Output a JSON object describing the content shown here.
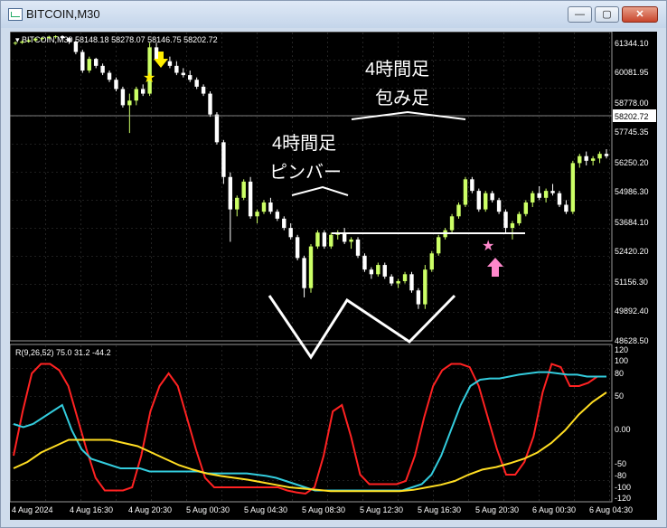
{
  "window": {
    "title": "BITCOIN,M30",
    "buttons": {
      "minimize": "—",
      "maximize": "▢",
      "close": "✕"
    }
  },
  "chart": {
    "info_line": "▾ BITCOIN,M30  58148.18 58278.07 58146.75 58202.72",
    "current_price": "58202.72",
    "price_axis": [
      "61344.10",
      "60081.95",
      "58778.00",
      "57745.35",
      "56250.20",
      "54986.30",
      "53684.10",
      "52420.20",
      "51156.30",
      "49892.40",
      "48628.50"
    ],
    "annotations": {
      "pinbar_line1": "4時間足",
      "pinbar_line2": "ピンバー",
      "engulf_line1": "4時間足",
      "engulf_line2": "包み足"
    },
    "colors": {
      "bull": "#ccff66",
      "bear": "#ffffff",
      "star_yellow": "#ffee00",
      "star_pink": "#ff88cc"
    }
  },
  "indicator": {
    "label": "R(9,26,52) 75.0 31.2 -44.2",
    "axis": [
      "120",
      "100",
      "80",
      "50",
      "0.00",
      "-50",
      "-80",
      "-100",
      "-120"
    ]
  },
  "time_axis": [
    "4 Aug 2024",
    "4 Aug 16:30",
    "4 Aug 20:30",
    "5 Aug 00:30",
    "5 Aug 04:30",
    "5 Aug 08:30",
    "5 Aug 12:30",
    "5 Aug 16:30",
    "5 Aug 20:30",
    "6 Aug 00:30",
    "6 Aug 04:30"
  ],
  "chart_data": {
    "type": "candlestick",
    "symbol": "BITCOIN",
    "timeframe": "M30",
    "price_ohlc": [
      [
        61180,
        61260,
        61100,
        61200
      ],
      [
        61200,
        61300,
        61150,
        61250
      ],
      [
        61250,
        61350,
        61200,
        61300
      ],
      [
        61300,
        61420,
        61250,
        61380
      ],
      [
        61380,
        61450,
        61300,
        61400
      ],
      [
        61400,
        61500,
        61350,
        61450
      ],
      [
        61450,
        61520,
        61380,
        61480
      ],
      [
        61480,
        61520,
        61350,
        61400
      ],
      [
        61400,
        61450,
        61150,
        61250
      ],
      [
        61250,
        61300,
        60700,
        60800
      ],
      [
        60800,
        60900,
        59900,
        60000
      ],
      [
        60000,
        60600,
        59900,
        60500
      ],
      [
        60500,
        60550,
        60100,
        60200
      ],
      [
        60200,
        60300,
        59800,
        59900
      ],
      [
        59900,
        60000,
        59500,
        59600
      ],
      [
        59600,
        59700,
        59100,
        59200
      ],
      [
        59200,
        59300,
        58400,
        58500
      ],
      [
        58500,
        59000,
        57300,
        58700
      ],
      [
        58700,
        59300,
        58500,
        59200
      ],
      [
        59200,
        59400,
        58900,
        59000
      ],
      [
        59000,
        61200,
        58900,
        61000
      ],
      [
        61000,
        61200,
        60400,
        60500
      ],
      [
        60500,
        60700,
        60300,
        60400
      ],
      [
        60400,
        60600,
        60100,
        60200
      ],
      [
        60200,
        60400,
        59800,
        59900
      ],
      [
        59900,
        60100,
        59700,
        59800
      ],
      [
        59800,
        60000,
        59500,
        59600
      ],
      [
        59600,
        59700,
        59200,
        59300
      ],
      [
        59300,
        59400,
        58900,
        59000
      ],
      [
        59000,
        59100,
        58000,
        58100
      ],
      [
        58100,
        58200,
        56800,
        56900
      ],
      [
        56900,
        57000,
        55100,
        55400
      ],
      [
        55400,
        55600,
        52600,
        54000
      ],
      [
        54000,
        54600,
        53700,
        54500
      ],
      [
        54500,
        55300,
        54400,
        55200
      ],
      [
        55200,
        55400,
        53600,
        53700
      ],
      [
        53700,
        54000,
        53400,
        53900
      ],
      [
        53900,
        54400,
        53800,
        54300
      ],
      [
        54300,
        54500,
        53800,
        53900
      ],
      [
        53900,
        54000,
        53500,
        53600
      ],
      [
        53600,
        53700,
        53100,
        53200
      ],
      [
        53200,
        53400,
        52700,
        52800
      ],
      [
        52800,
        52900,
        51800,
        51900
      ],
      [
        51900,
        52000,
        50200,
        50600
      ],
      [
        50600,
        52500,
        50400,
        52400
      ],
      [
        52400,
        53100,
        52300,
        53000
      ],
      [
        53000,
        53100,
        52300,
        52400
      ],
      [
        52400,
        53000,
        52300,
        52900
      ],
      [
        52900,
        53100,
        52700,
        53000
      ],
      [
        53000,
        53200,
        52500,
        52600
      ],
      [
        52600,
        52800,
        52300,
        52700
      ],
      [
        52700,
        52800,
        51900,
        52000
      ],
      [
        52000,
        52100,
        51300,
        51400
      ],
      [
        51400,
        51500,
        51000,
        51200
      ],
      [
        51200,
        51700,
        51100,
        51600
      ],
      [
        51600,
        51700,
        51000,
        51100
      ],
      [
        51100,
        51200,
        50700,
        50800
      ],
      [
        50800,
        51000,
        50600,
        50900
      ],
      [
        50900,
        51300,
        50800,
        51200
      ],
      [
        51200,
        51300,
        50400,
        50500
      ],
      [
        50500,
        50600,
        49700,
        49900
      ],
      [
        49900,
        51600,
        49700,
        51400
      ],
      [
        51400,
        52200,
        51300,
        52100
      ],
      [
        52100,
        52900,
        52000,
        52800
      ],
      [
        52800,
        53200,
        52700,
        53100
      ],
      [
        53100,
        53800,
        53000,
        53700
      ],
      [
        53700,
        54300,
        53600,
        54200
      ],
      [
        54200,
        55400,
        54100,
        55300
      ],
      [
        55300,
        55400,
        54700,
        54800
      ],
      [
        54800,
        54900,
        53900,
        54000
      ],
      [
        54000,
        54800,
        53900,
        54700
      ],
      [
        54700,
        54800,
        54300,
        54400
      ],
      [
        54400,
        54500,
        53800,
        53900
      ],
      [
        53900,
        54000,
        53000,
        53200
      ],
      [
        53200,
        53500,
        52700,
        53400
      ],
      [
        53400,
        53900,
        53300,
        53800
      ],
      [
        53800,
        54400,
        53700,
        54300
      ],
      [
        54300,
        54800,
        54100,
        54700
      ],
      [
        54700,
        55000,
        54400,
        54500
      ],
      [
        54500,
        54900,
        54300,
        54800
      ],
      [
        54800,
        55100,
        54600,
        54700
      ],
      [
        54700,
        54800,
        54100,
        54200
      ],
      [
        54200,
        54400,
        53800,
        53900
      ],
      [
        53900,
        56100,
        53800,
        56000
      ],
      [
        56000,
        56400,
        55800,
        56300
      ],
      [
        56300,
        56500,
        55900,
        56100
      ],
      [
        56100,
        56300,
        55900,
        56200
      ],
      [
        56200,
        56500,
        56000,
        56400
      ],
      [
        56400,
        56600,
        56200,
        56300
      ]
    ],
    "oscillator": {
      "name": "R(9,26,52)",
      "ylim": [
        -120,
        120
      ],
      "series": [
        {
          "name": "9",
          "color": "#ff2222",
          "values": [
            -50,
            20,
            80,
            95,
            95,
            85,
            60,
            10,
            -40,
            -85,
            -105,
            -105,
            -105,
            -100,
            -50,
            20,
            60,
            80,
            60,
            10,
            -40,
            -85,
            -100,
            -100,
            -100,
            -100,
            -100,
            -100,
            -100,
            -100,
            -105,
            -108,
            -110,
            -100,
            -50,
            20,
            30,
            -20,
            -80,
            -95,
            -95,
            -95,
            -95,
            -90,
            -50,
            10,
            60,
            85,
            95,
            95,
            90,
            60,
            10,
            -40,
            -80,
            -80,
            -60,
            -20,
            50,
            95,
            90,
            60,
            60,
            65,
            75,
            75
          ]
        },
        {
          "name": "26",
          "color": "#33ccdd",
          "values": [
            0,
            -5,
            0,
            10,
            20,
            30,
            -10,
            -40,
            -55,
            -60,
            -65,
            -70,
            -70,
            -70,
            -75,
            -75,
            -75,
            -75,
            -75,
            -75,
            -78,
            -78,
            -78,
            -78,
            -78,
            -80,
            -82,
            -85,
            -90,
            -95,
            -100,
            -105,
            -105,
            -105,
            -105,
            -105,
            -105,
            -105,
            -105,
            -105,
            -105,
            -100,
            -95,
            -80,
            -50,
            -10,
            30,
            60,
            70,
            72,
            72,
            75,
            78,
            80,
            82,
            82,
            80,
            78,
            78,
            75,
            75,
            75
          ]
        },
        {
          "name": "52",
          "color": "#ffdd22",
          "values": [
            -70,
            -60,
            -45,
            -35,
            -25,
            -25,
            -25,
            -25,
            -30,
            -35,
            -45,
            -55,
            -65,
            -72,
            -78,
            -82,
            -85,
            -88,
            -92,
            -96,
            -100,
            -102,
            -104,
            -106,
            -106,
            -106,
            -106,
            -106,
            -106,
            -104,
            -100,
            -96,
            -90,
            -80,
            -72,
            -68,
            -62,
            -55,
            -45,
            -30,
            -10,
            15,
            35,
            50
          ]
        }
      ]
    }
  }
}
